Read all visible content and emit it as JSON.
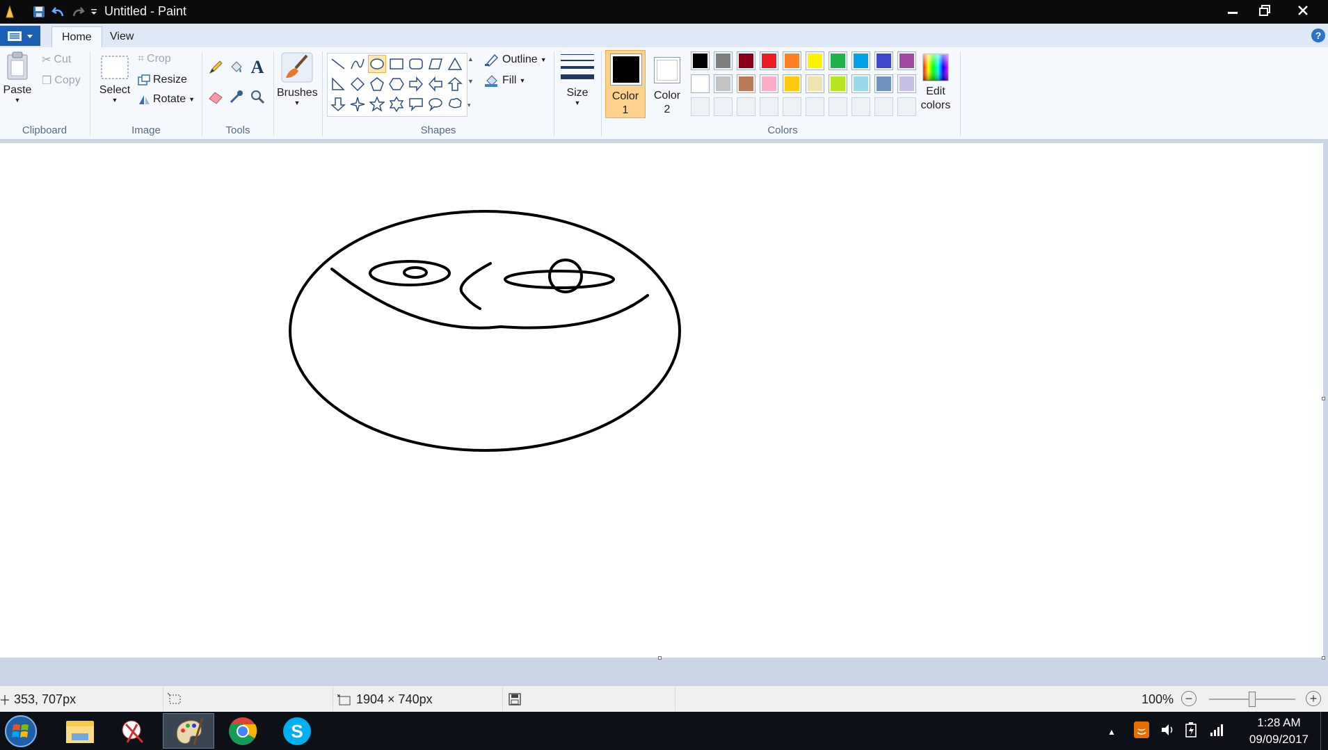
{
  "window": {
    "title": "Untitled - Paint"
  },
  "tabs": {
    "file_icon": "menu-icon",
    "home": "Home",
    "view": "View"
  },
  "clipboard": {
    "paste": "Paste",
    "cut": "Cut",
    "copy": "Copy",
    "label": "Clipboard"
  },
  "image": {
    "select": "Select",
    "crop": "Crop",
    "resize": "Resize",
    "rotate": "Rotate",
    "label": "Image"
  },
  "tools": {
    "label": "Tools",
    "items": [
      "pencil-icon",
      "fill-icon",
      "text-icon",
      "eraser-icon",
      "color-picker-icon",
      "magnifier-icon"
    ]
  },
  "brushes": {
    "label": "Brushes"
  },
  "shapes": {
    "label": "Shapes",
    "outline": "Outline",
    "fill": "Fill",
    "selected": "oval"
  },
  "size": {
    "label": "Size"
  },
  "colors": {
    "label": "Colors",
    "color1_line1": "Color",
    "color1_line2": "1",
    "color2_line1": "Color",
    "color2_line2": "2",
    "color1_value": "#000000",
    "color2_value": "#ffffff",
    "edit_line1": "Edit",
    "edit_line2": "colors",
    "palette_row1": [
      "#000000",
      "#7f7f7f",
      "#880015",
      "#ed1c24",
      "#ff7f27",
      "#fff200",
      "#22b14c",
      "#00a2e8",
      "#3f48cc",
      "#a349a4"
    ],
    "palette_row2": [
      "#ffffff",
      "#c3c3c3",
      "#b97a57",
      "#ffaec9",
      "#ffc90e",
      "#efe4b0",
      "#b5e61d",
      "#99d9ea",
      "#7092be",
      "#c8bfe7"
    ]
  },
  "status": {
    "cursor_pos": "353, 707px",
    "canvas_size": "1904 × 740px",
    "zoom": "100%"
  },
  "taskbar": {
    "time": "1:28 AM",
    "date": "09/09/2017"
  }
}
